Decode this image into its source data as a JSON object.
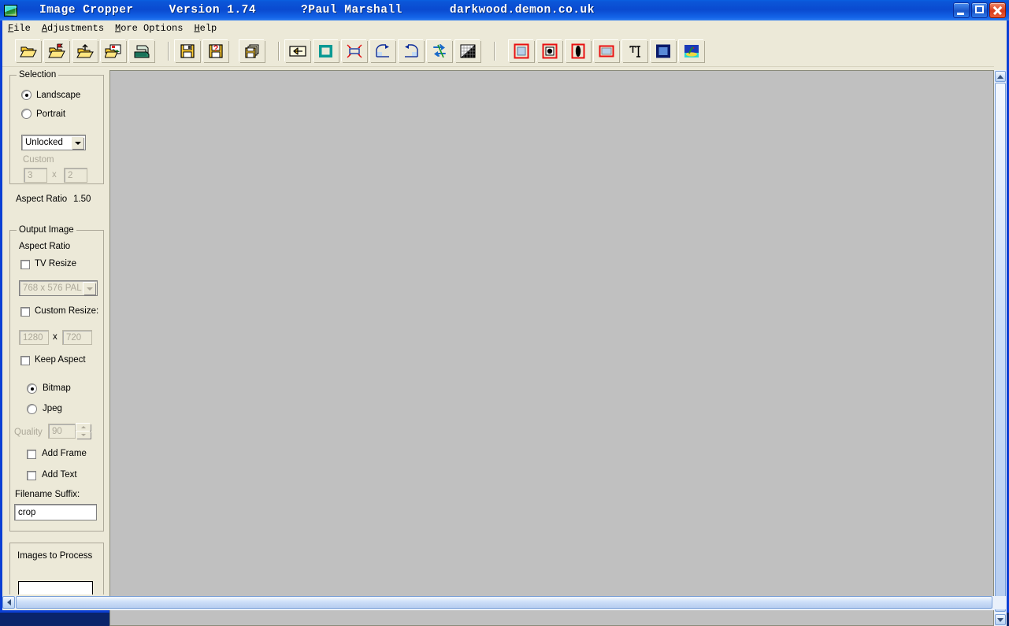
{
  "window": {
    "title_app": "Image Cropper",
    "title_version": "Version 1.74",
    "title_author": "?Paul Marshall",
    "title_site": "darkwood.demon.co.uk",
    "icon": "app-image-icon",
    "buttons": {
      "minimize": "minimize",
      "maximize": "maximize",
      "close": "close"
    }
  },
  "menubar": {
    "items": [
      {
        "label": "File",
        "accel": "F"
      },
      {
        "label": "Adjustments",
        "accel": "A"
      },
      {
        "label": "More Options",
        "accel": "M"
      },
      {
        "label": "Help",
        "accel": "H"
      }
    ]
  },
  "toolbar": {
    "groups": [
      {
        "buttons": [
          {
            "icon": "open-folder-icon",
            "name": "open-image"
          },
          {
            "icon": "open-folder-flag-icon",
            "name": "open-recent"
          },
          {
            "icon": "folder-up-arrow-icon",
            "name": "open-folder-batch"
          },
          {
            "icon": "folder-image-icon",
            "name": "open-image-list"
          },
          {
            "icon": "printer-icon",
            "name": "print"
          }
        ]
      },
      {
        "buttons": [
          {
            "icon": "floppy-save-icon",
            "name": "save"
          },
          {
            "icon": "floppy-question-icon",
            "name": "save-as"
          },
          {
            "icon": "stacked-floppy-icon",
            "name": "batch-save"
          }
        ]
      },
      {
        "buttons": [
          {
            "icon": "back-arrow-icon",
            "name": "undo-revert"
          },
          {
            "icon": "crop-square-icon",
            "name": "crop"
          },
          {
            "icon": "resize-arrows-icon",
            "name": "resize"
          },
          {
            "icon": "rotate-right-icon",
            "name": "rotate-right"
          },
          {
            "icon": "rotate-left-icon",
            "name": "rotate-left"
          },
          {
            "icon": "flip-icon",
            "name": "flip"
          },
          {
            "icon": "gradient-grid-icon",
            "name": "adjust-levels"
          }
        ]
      },
      {
        "buttons": [
          {
            "icon": "frame-square-icon",
            "name": "add-frame"
          },
          {
            "icon": "frame-dot-icon",
            "name": "frame-centre"
          },
          {
            "icon": "frame-ellipse-icon",
            "name": "frame-vignette"
          },
          {
            "icon": "frame-plain-icon",
            "name": "frame-plain"
          },
          {
            "icon": "text-tool-icon",
            "name": "add-text"
          },
          {
            "icon": "navy-square-icon",
            "name": "border-colour"
          },
          {
            "icon": "landscape-photo-icon",
            "name": "preview-image"
          }
        ]
      }
    ]
  },
  "selection": {
    "title": "Selection",
    "orientation": {
      "landscape": {
        "label": "Landscape",
        "selected": true
      },
      "portrait": {
        "label": "Portrait",
        "selected": false
      }
    },
    "lock_combo": {
      "value": "Unlocked",
      "enabled": true
    },
    "custom_label": {
      "text": "Custom",
      "enabled": false
    },
    "custom_width": {
      "value": "3",
      "enabled": false
    },
    "custom_sep": "x",
    "custom_height": {
      "value": "2",
      "enabled": false
    },
    "aspect_ratio_label": "Aspect Ratio",
    "aspect_ratio_value": "1.50"
  },
  "output_image": {
    "title": "Output Image",
    "aspect_ratio_label": "Aspect Ratio",
    "tv_resize": {
      "label": "TV Resize",
      "checked": false
    },
    "tv_combo": {
      "value": "768 x 576  PAL",
      "enabled": false
    },
    "custom_resize": {
      "label": "Custom Resize:",
      "checked": false
    },
    "custom_width": {
      "value": "1280",
      "enabled": false
    },
    "custom_sep": "x",
    "custom_height": {
      "value": "720",
      "enabled": false
    },
    "keep_aspect": {
      "label": "Keep Aspect",
      "checked": false
    },
    "format_bitmap": {
      "label": "Bitmap",
      "selected": true
    },
    "format_jpeg": {
      "label": "Jpeg",
      "selected": false
    },
    "quality_label": {
      "text": "Quality",
      "enabled": false
    },
    "quality_value": {
      "value": "90",
      "enabled": false
    },
    "add_frame": {
      "label": "Add Frame",
      "checked": false
    },
    "add_text": {
      "label": "Add Text",
      "checked": false
    },
    "filename_suffix_label": "Filename Suffix:",
    "filename_suffix_value": "crop"
  },
  "images_to_process": {
    "title": "Images to Process"
  },
  "canvas": {
    "background_colour": "#c0c0c0",
    "content": ""
  },
  "scrollbars": {
    "vertical": {
      "up": "scroll-up",
      "down": "scroll-down"
    },
    "horizontal_canvas": {
      "left": "scroll-left",
      "right": "scroll-right"
    },
    "horizontal_main": {
      "left": "scroll-left",
      "right": "scroll-right"
    }
  },
  "colors": {
    "titlebar": "#0b4ad0",
    "face": "#ece9d8",
    "canvas": "#c0c0c0",
    "accent_teal": "#0a9a94",
    "accent_red": "#e81010",
    "accent_navy": "#1a2a8a"
  }
}
